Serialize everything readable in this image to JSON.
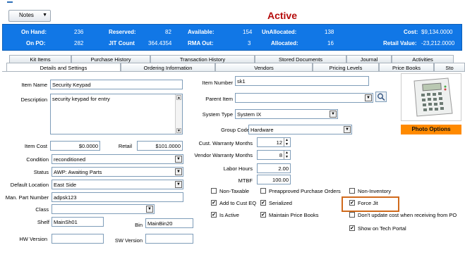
{
  "notes_button": "Notes",
  "status": "Active",
  "summary": {
    "on_hand_label": "On Hand:",
    "on_hand": "236",
    "reserved_label": "Reserved:",
    "reserved": "82",
    "available_label": "Available:",
    "available": "154",
    "unallocated_label": "UnAllocated:",
    "unallocated": "138",
    "cost_label": "Cost:",
    "cost": "$9,134.0000",
    "on_po_label": "On PO:",
    "on_po": "282",
    "jit_label": "JIT Count",
    "jit": "364.4354",
    "rma_label": "RMA Out:",
    "rma": "3",
    "allocated_label": "Allocated:",
    "allocated": "16",
    "retail_value_label": "Retail Value:",
    "retail_value": "-23,212.0000"
  },
  "tabs_row1": [
    "Kit Items",
    "Purchase History",
    "Transaction History",
    "Stored Documents",
    "Journal",
    "Activities"
  ],
  "tabs_row2": [
    "Details and Settings",
    "Ordering Information",
    "Vendors",
    "Pricing Levels",
    "Price Books",
    "Sto"
  ],
  "form": {
    "item_name_label": "Item Name",
    "item_name": "Security Keypad",
    "description_label": "Description",
    "description": "security keypad for entry",
    "item_cost_label": "Item Cost",
    "item_cost": "$0.0000",
    "retail_label": "Retail",
    "retail": "$101.0000",
    "condition_label": "Condition",
    "condition": "reconditioned",
    "status_label": "Status",
    "status": "AWP: Awaiting Parts",
    "default_location_label": "Default Location",
    "default_location": "East Side",
    "man_part_label": "Man. Part Number",
    "man_part": "adpsk123",
    "class_label": "Class",
    "class": "",
    "shelf_label": "Shelf",
    "shelf": "MainSh01",
    "bin_label": "Bin",
    "bin": "MainBin20",
    "hw_version_label": "HW Version",
    "hw_version": "",
    "sw_version_label": "SW Version",
    "sw_version": "",
    "item_number_label": "Item Number",
    "item_number": "sk1",
    "parent_item_label": "Parent Item",
    "parent_item": "",
    "system_type_label": "System Type",
    "system_type": "System IX",
    "group_code_label": "Group Code",
    "group_code": "Hardware",
    "cust_warranty_label": "Cust. Warranty Months",
    "cust_warranty": "12",
    "vendor_warranty_label": "Vendor Warranty Months",
    "vendor_warranty": "8",
    "labor_hours_label": "Labor Hours",
    "labor_hours": "2.00",
    "mtbf_label": "MTBF",
    "mtbf": "100.00"
  },
  "checkboxes": {
    "non_taxable": {
      "label": "Non-Taxable",
      "checked": false
    },
    "preapproved": {
      "label": "Preapproved Purchase Orders",
      "checked": false
    },
    "non_inventory": {
      "label": "Non-Inventory",
      "checked": false
    },
    "add_to_cust_eq": {
      "label": "Add to Cust EQ",
      "checked": true
    },
    "serialized": {
      "label": "Serialized",
      "checked": true
    },
    "force_jit": {
      "label": "Force Jit",
      "checked": true
    },
    "is_active": {
      "label": "Is Active",
      "checked": true
    },
    "maintain_price_books": {
      "label": "Maintain Price Books",
      "checked": true
    },
    "dont_update_cost": {
      "label": "Don't update cost when receiving from PO",
      "checked": false
    },
    "show_on_tech_portal": {
      "label": "Show on Tech Portal",
      "checked": true
    }
  },
  "photo_options": "Photo Options",
  "colors": {
    "summary_bar": "#1177e6",
    "status_text": "#b50b0b",
    "photo_button": "#ff8a00",
    "highlight": "#d06a1c"
  },
  "icons": {
    "search": "magnifier-icon",
    "photo": "keypad-photo"
  }
}
